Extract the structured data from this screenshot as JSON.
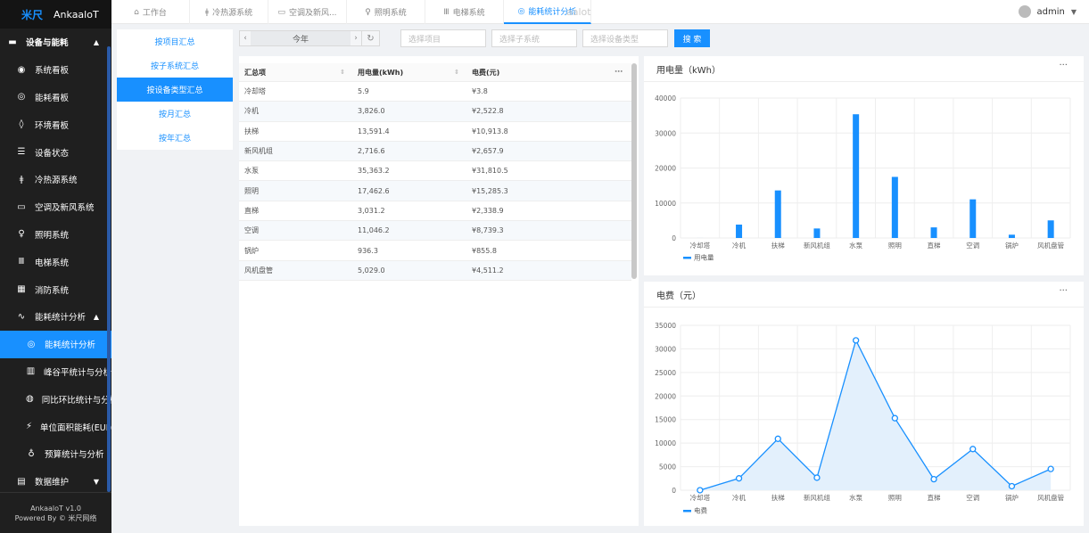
{
  "app": {
    "logo_mark": "米尺",
    "logo_text": "AnkaaloT"
  },
  "sidebar": {
    "items": [
      {
        "label": "设备与能耗",
        "icon": "▬",
        "group": true,
        "caret": "▲"
      },
      {
        "label": "系统看板",
        "icon": "◉"
      },
      {
        "label": "能耗看板",
        "icon": "◎"
      },
      {
        "label": "环境看板",
        "icon": "◊"
      },
      {
        "label": "设备状态",
        "icon": "☰"
      },
      {
        "label": "冷热源系统",
        "icon": "ǂ"
      },
      {
        "label": "空调及新风系统",
        "icon": "▭"
      },
      {
        "label": "照明系统",
        "icon": "♀"
      },
      {
        "label": "电梯系统",
        "icon": "Ⅲ"
      },
      {
        "label": "消防系统",
        "icon": "▦"
      },
      {
        "label": "能耗统计分析",
        "icon": "∿",
        "caret": "▲"
      },
      {
        "label": "能耗统计分析",
        "icon": "◎",
        "active": true,
        "sub": true
      },
      {
        "label": "峰谷平统计与分析",
        "icon": "▥",
        "sub": true
      },
      {
        "label": "同比环比统计与分析",
        "icon": "◍",
        "sub": true
      },
      {
        "label": "单位面积能耗(EUI)",
        "icon": "⚡",
        "sub": true
      },
      {
        "label": "预算统计与分析",
        "icon": "♁",
        "sub": true
      },
      {
        "label": "数据维护",
        "icon": "▤",
        "caret": "▼"
      }
    ],
    "footer_line1": "AnkaaloT v1.0",
    "footer_line2": "Powered By © 米尺网络"
  },
  "header": {
    "tabs": [
      {
        "label": "工作台",
        "icon": "⌂"
      },
      {
        "label": "冷热源系统",
        "icon": "ǂ"
      },
      {
        "label": "空调及新风...",
        "icon": "▭"
      },
      {
        "label": "照明系统",
        "icon": "♀"
      },
      {
        "label": "电梯系统",
        "icon": "Ⅲ"
      },
      {
        "label": "能耗统计分析",
        "icon": "◎",
        "active": true
      }
    ],
    "ghost_text": "aalot",
    "user": "admin",
    "user_caret": "▼"
  },
  "subnav": {
    "items": [
      {
        "label": "按项目汇总"
      },
      {
        "label": "按子系统汇总"
      },
      {
        "label": "按设备类型汇总",
        "active": true
      },
      {
        "label": "按月汇总"
      },
      {
        "label": "按年汇总"
      }
    ]
  },
  "filters": {
    "period_prev": "‹",
    "period_value": "今年",
    "period_next": "›",
    "refresh_icon": "↻",
    "project_placeholder": "选择项目",
    "subsystem_placeholder": "选择子系统",
    "device_type_placeholder": "选择设备类型",
    "query_label": "搜 索"
  },
  "table": {
    "columns": [
      "汇总项",
      "用电量(kWh)",
      "电费(元)"
    ],
    "sort_icon": "⇕",
    "more_icon": "⋯",
    "rows": [
      {
        "name": "冷却塔",
        "kwh": "5.9",
        "cost": "¥3.8"
      },
      {
        "name": "冷机",
        "kwh": "3,826.0",
        "cost": "¥2,522.8"
      },
      {
        "name": "扶梯",
        "kwh": "13,591.4",
        "cost": "¥10,913.8"
      },
      {
        "name": "新风机组",
        "kwh": "2,716.6",
        "cost": "¥2,657.9"
      },
      {
        "name": "水泵",
        "kwh": "35,363.2",
        "cost": "¥31,810.5"
      },
      {
        "name": "照明",
        "kwh": "17,462.6",
        "cost": "¥15,285.3"
      },
      {
        "name": "直梯",
        "kwh": "3,031.2",
        "cost": "¥2,338.9"
      },
      {
        "name": "空调",
        "kwh": "11,046.2",
        "cost": "¥8,739.3"
      },
      {
        "name": "锅炉",
        "kwh": "936.3",
        "cost": "¥855.8"
      },
      {
        "name": "风机盘管",
        "kwh": "5,029.0",
        "cost": "¥4,511.2"
      }
    ]
  },
  "colors": {
    "accent": "#1890ff",
    "sidebar_bg": "#1f1f1f",
    "area_fill": "#e3f0fc"
  },
  "panels": {
    "more_icon": "···"
  },
  "chart_data": [
    {
      "type": "bar",
      "title": "用电量（kWh）",
      "categories": [
        "冷却塔",
        "冷机",
        "扶梯",
        "新风机组",
        "水泵",
        "照明",
        "直梯",
        "空调",
        "锅炉",
        "风机盘管"
      ],
      "series": [
        {
          "name": "用电量",
          "values": [
            5.9,
            3826.0,
            13591.4,
            2716.6,
            35363.2,
            17462.6,
            3031.2,
            11046.2,
            936.3,
            5029.0
          ]
        }
      ],
      "ylim": [
        0,
        40000
      ],
      "yticks": [
        0,
        10000,
        20000,
        30000,
        40000
      ],
      "grid": true,
      "legend": "bottom-left"
    },
    {
      "type": "area",
      "title": "电费（元）",
      "categories": [
        "冷却塔",
        "冷机",
        "扶梯",
        "新风机组",
        "水泵",
        "照明",
        "直梯",
        "空调",
        "锅炉",
        "风机盘管"
      ],
      "series": [
        {
          "name": "电费",
          "values": [
            3.8,
            2522.8,
            10913.8,
            2657.9,
            31810.5,
            15285.3,
            2338.9,
            8739.3,
            855.8,
            4511.2
          ]
        }
      ],
      "ylim": [
        0,
        35000
      ],
      "yticks": [
        0,
        5000,
        10000,
        15000,
        20000,
        25000,
        30000,
        35000
      ],
      "grid": true,
      "legend": "bottom-left"
    }
  ]
}
